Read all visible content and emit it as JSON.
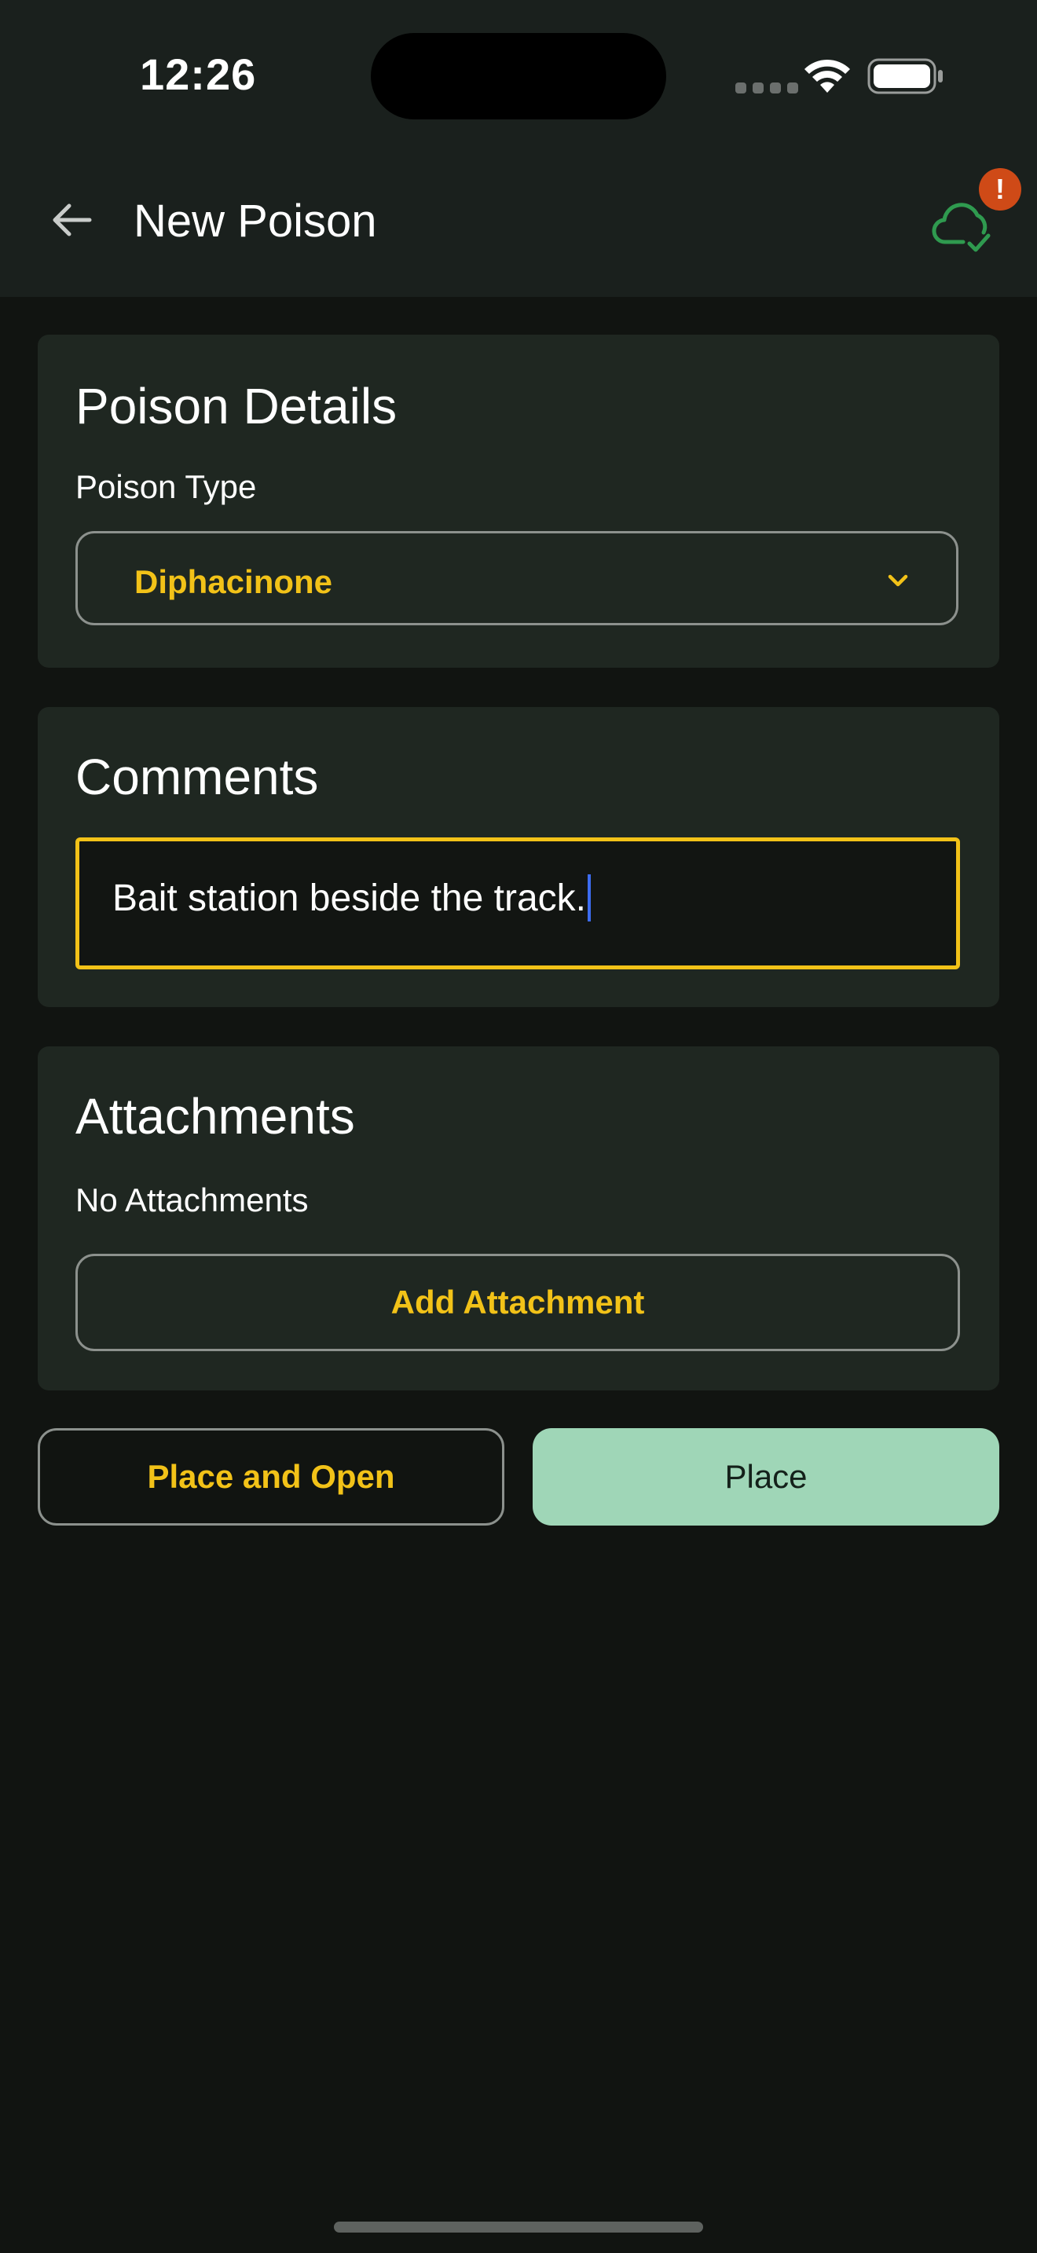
{
  "status_bar": {
    "time": "12:26",
    "icons": [
      "cellular-signal-icon",
      "wifi-icon",
      "battery-icon"
    ]
  },
  "app_bar": {
    "title": "New Poison",
    "back_icon": "arrow-left-icon",
    "sync_icon": "cloud-check-icon",
    "sync_badge": "!"
  },
  "poison_details": {
    "title": "Poison Details",
    "poison_type_label": "Poison Type",
    "poison_type_value": "Diphacinone"
  },
  "comments": {
    "title": "Comments",
    "value": "Bait station beside the track."
  },
  "attachments": {
    "title": "Attachments",
    "empty_text": "No Attachments",
    "add_label": "Add Attachment"
  },
  "actions": {
    "place_and_open_label": "Place and Open",
    "place_label": "Place"
  },
  "colors": {
    "background": "#111411",
    "surface": "#1f2721",
    "accent": "#f2c218",
    "primary_button": "#9fd6b7",
    "sync_icon": "#2f9a4f",
    "badge": "#cf4a17",
    "caret": "#3d6cf0"
  }
}
